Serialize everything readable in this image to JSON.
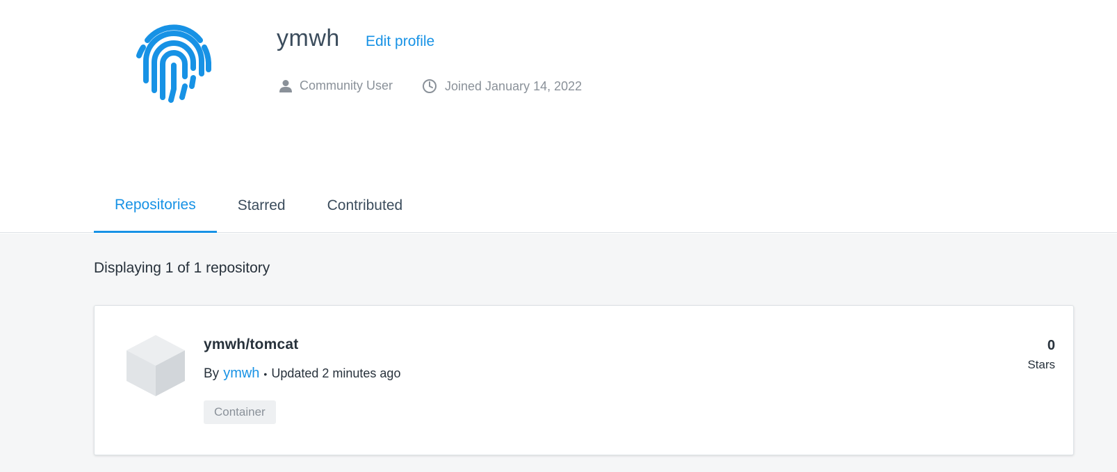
{
  "profile": {
    "username": "ymwh",
    "edit_label": "Edit profile",
    "user_type": "Community User",
    "joined": "Joined January 14, 2022",
    "avatar_icon": "fingerprint-icon",
    "accent_color": "#1792e5"
  },
  "tabs": [
    {
      "label": "Repositories",
      "active": true
    },
    {
      "label": "Starred",
      "active": false
    },
    {
      "label": "Contributed",
      "active": false
    }
  ],
  "listing": {
    "count_text": "Displaying 1 of 1 repository"
  },
  "repositories": [
    {
      "name": "ymwh/tomcat",
      "by_label": "By",
      "owner": "ymwh",
      "separator": "•",
      "updated": "Updated 2 minutes ago",
      "badge": "Container",
      "stars_count": "0",
      "stars_label": "Stars",
      "icon": "cube-icon"
    }
  ]
}
